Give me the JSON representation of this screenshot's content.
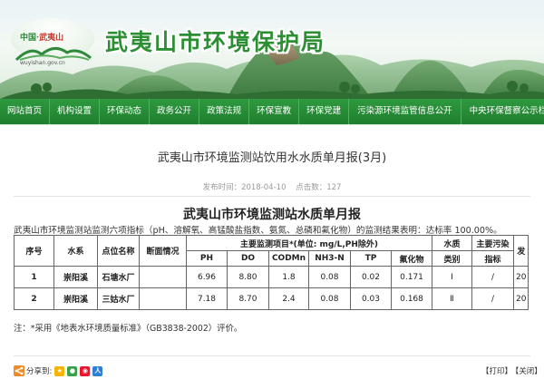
{
  "header": {
    "logo_text_left": "中国·",
    "logo_text_right": "武夷山",
    "logo_domain": "wuyishan.gov.cn",
    "site_title": "武夷山市环境保护局"
  },
  "nav": {
    "items": [
      "网站首页",
      "机构设置",
      "环保动态",
      "政务公开",
      "政策法规",
      "环保宣教",
      "环保党建",
      "污染源环境监管信息公开",
      "中央环保督察公示栏"
    ]
  },
  "article": {
    "title": "武夷山市环境监测站饮用水水质单月报(3月)",
    "publish_date": "发布时间：2018-04-10",
    "views": "点击数：127",
    "doc_title": "武夷山市环境监测站水质单月报",
    "intro": "武夷山市环境监测站监测六项指标（pH、溶解氧、高锰酸盐指数、氨氮、总磷和氟化物）的监测结果表明：达标率 100.00%。",
    "table": {
      "headers": {
        "seq": "序号",
        "system": "水系",
        "site": "点位名称",
        "flow": "断面情况",
        "main_items": "主要监测项目*(单位: mg/L,PH除外)",
        "quality": "水质",
        "quality_sub": "类别",
        "pollution": "主要污染",
        "pollution_sub": "指标",
        "extra": "发",
        "params": [
          "PH",
          "DO",
          "CODMn",
          "NH3-N",
          "TP",
          "氟化物"
        ]
      },
      "rows": [
        {
          "seq": "1",
          "system": "崇阳溪",
          "site": "石塘水厂",
          "flow": "",
          "values": [
            "6.96",
            "8.80",
            "1.8",
            "0.08",
            "0.02",
            "0.171"
          ],
          "quality": "Ⅰ",
          "pollution": "/",
          "extra": "20"
        },
        {
          "seq": "2",
          "system": "崇阳溪",
          "site": "三姑水厂",
          "flow": "",
          "values": [
            "7.18",
            "8.70",
            "2.4",
            "0.08",
            "0.03",
            "0.168"
          ],
          "quality": "Ⅱ",
          "pollution": "/",
          "extra": "20"
        }
      ]
    },
    "note": "注：*采用《地表水环境质量标准》（GB3838-2002）评价。"
  },
  "footer": {
    "share_label": "分享到:",
    "share_icons": [
      "qzone-icon",
      "wechat-icon",
      "weibo-icon",
      "renren-icon"
    ],
    "print_label": "【打印】",
    "close_label": "【关闭】"
  },
  "colors": {
    "brand_green": "#2c8f33",
    "nav_green": "#1f7d2e"
  }
}
